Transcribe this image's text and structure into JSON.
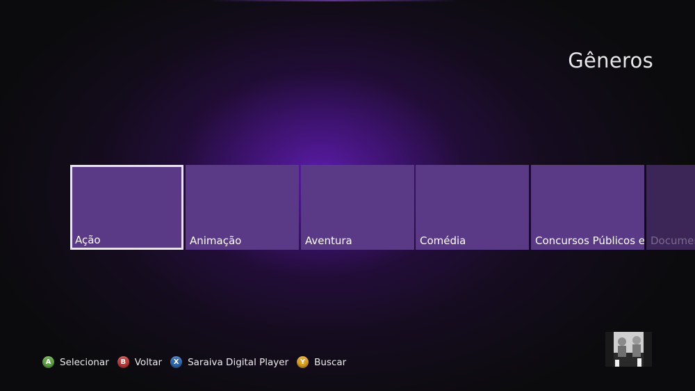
{
  "page": {
    "title": "Gêneros"
  },
  "genres": [
    {
      "label": "Ação",
      "selected": true
    },
    {
      "label": "Animação",
      "selected": false
    },
    {
      "label": "Aventura",
      "selected": false
    },
    {
      "label": "Comédia",
      "selected": false
    },
    {
      "label": "Concursos Públicos e",
      "selected": false
    },
    {
      "label": "Documen",
      "selected": false
    }
  ],
  "hints": [
    {
      "button": "A",
      "label": "Selecionar",
      "color": "#5fa544"
    },
    {
      "button": "B",
      "label": "Voltar",
      "color": "#c23a3a"
    },
    {
      "button": "X",
      "label": "Saraiva Digital Player",
      "color": "#2f69b5"
    },
    {
      "button": "Y",
      "label": "Buscar",
      "color": "#e0a11c"
    }
  ],
  "colors": {
    "tile": "#5a3a87",
    "tile_selected_border": "#e9e6ee",
    "background_glow": "#5c1caa"
  },
  "avatar": {
    "icon": "profile-avatar-icon"
  }
}
